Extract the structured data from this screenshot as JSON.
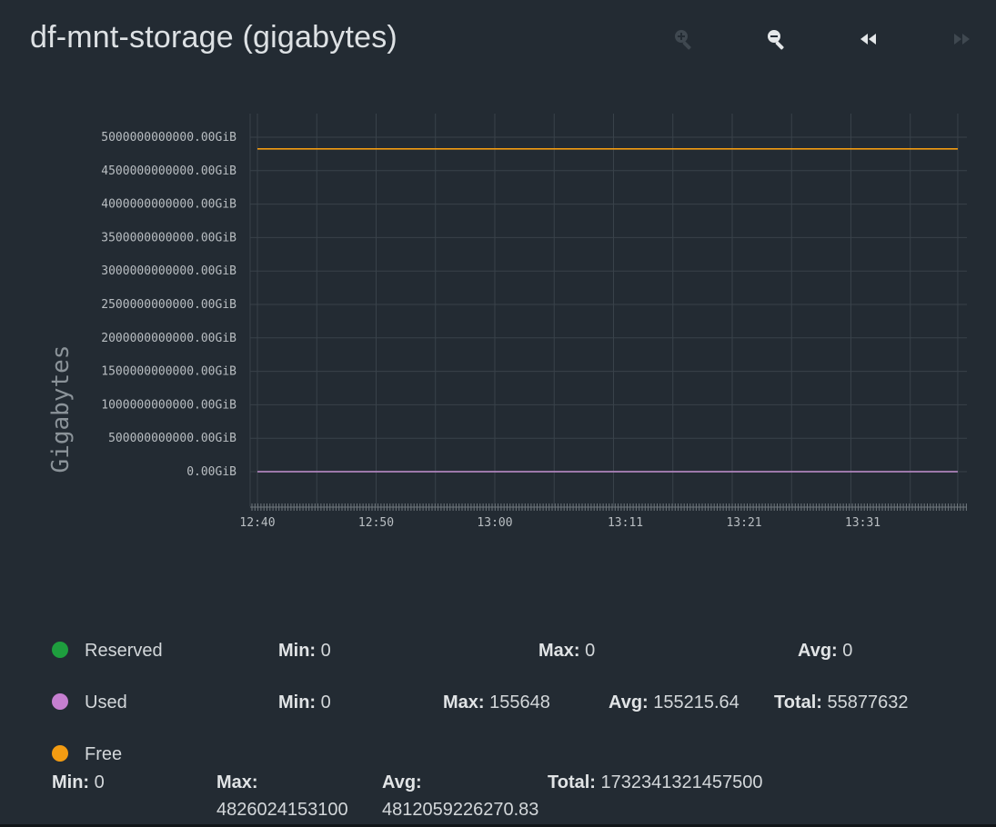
{
  "header": {
    "title": "df-mnt-storage (gigabytes)"
  },
  "toolbar": {
    "buttons": [
      {
        "name": "zoom-in-button",
        "icon": "zoom-in-icon",
        "enabled": false
      },
      {
        "name": "zoom-out-button",
        "icon": "zoom-out-icon",
        "enabled": true
      },
      {
        "name": "step-back-button",
        "icon": "rewind-icon",
        "enabled": true
      },
      {
        "name": "step-forward-button",
        "icon": "fast-forward-icon",
        "enabled": false
      }
    ]
  },
  "chart_data": {
    "type": "line",
    "title": "",
    "ylabel": "Gigabytes",
    "xlabel": "",
    "ylim": [
      0,
      5000000000000
    ],
    "y_ticks": [
      "0.00GiB",
      "500000000000.00GiB",
      "1000000000000.00GiB",
      "1500000000000.00GiB",
      "2000000000000.00GiB",
      "2500000000000.00GiB",
      "3000000000000.00GiB",
      "3500000000000.00GiB",
      "4000000000000.00GiB",
      "4500000000000.00GiB",
      "5000000000000.00GiB"
    ],
    "x_ticks": [
      "12:40",
      "12:50",
      "13:00",
      "13:11",
      "13:21",
      "13:31"
    ],
    "grid": true,
    "series": [
      {
        "name": "Reserved",
        "color": "#1e9e3e",
        "x": [
          "12:40",
          "13:39"
        ],
        "values": [
          0,
          0
        ]
      },
      {
        "name": "Used",
        "color": "#c57fd0",
        "x": [
          "12:40",
          "13:39"
        ],
        "values": [
          155648,
          155648
        ]
      },
      {
        "name": "Free",
        "color": "#f39c12",
        "x": [
          "12:40",
          "13:39"
        ],
        "values": [
          4826024153100,
          4826024153100
        ]
      }
    ]
  },
  "legend": {
    "reserved": {
      "label": "Reserved",
      "color": "#1e9e3e",
      "min_label": "Min:",
      "min": "0",
      "max_label": "Max:",
      "max": "0",
      "avg_label": "Avg:",
      "avg": "0"
    },
    "used": {
      "label": "Used",
      "color": "#c57fd0",
      "min_label": "Min:",
      "min": "0",
      "max_label": "Max:",
      "max": "155648",
      "avg_label": "Avg:",
      "avg": "155215.64",
      "total_label": "Total:",
      "total": "55877632"
    },
    "free": {
      "label": "Free",
      "color": "#f39c12",
      "min_label": "Min:",
      "min": "0",
      "max_label": "Max:",
      "max": "4826024153100",
      "avg_label": "Avg:",
      "avg": "4812059226270.83",
      "total_label": "Total:",
      "total": "1732341321457500"
    }
  }
}
